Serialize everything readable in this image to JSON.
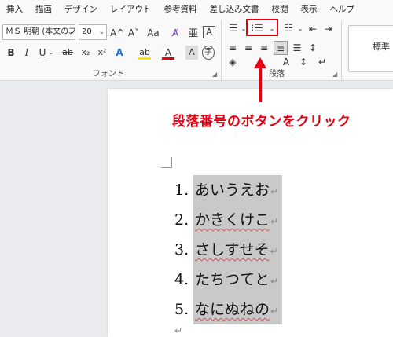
{
  "menu": [
    "挿入",
    "描画",
    "デザイン",
    "レイアウト",
    "参考資料",
    "差し込み文書",
    "校閲",
    "表示",
    "ヘルプ"
  ],
  "font_group": {
    "font_name": "ＭＳ 明朝 (本文のフ",
    "font_size": "20",
    "label": "フォント",
    "buttons": {
      "grow": "A^",
      "shrink": "Aˇ",
      "case": "Aa",
      "clear": "A̸",
      "char_border": "A",
      "bold": "B",
      "italic": "I",
      "underline": "U",
      "strike": "ab",
      "subscript": "x₂",
      "superscript": "x²",
      "effects": "A",
      "highlight": "ab",
      "font_color": "A",
      "enclose": "字"
    }
  },
  "para_group": {
    "label": "段落"
  },
  "styles": {
    "label": "標準"
  },
  "annotation": "段落番号のボタンをクリック",
  "list": [
    {
      "num": "1.",
      "text": "あいうえお"
    },
    {
      "num": "2.",
      "text": "かきくけこ"
    },
    {
      "num": "3.",
      "text": "さしすせそ"
    },
    {
      "num": "4.",
      "text": "たちつてと"
    },
    {
      "num": "5.",
      "text": "なにぬねの"
    }
  ],
  "para_mark": "↵",
  "colors": {
    "accent": "#e60012",
    "selection": "#c9c9c9"
  }
}
